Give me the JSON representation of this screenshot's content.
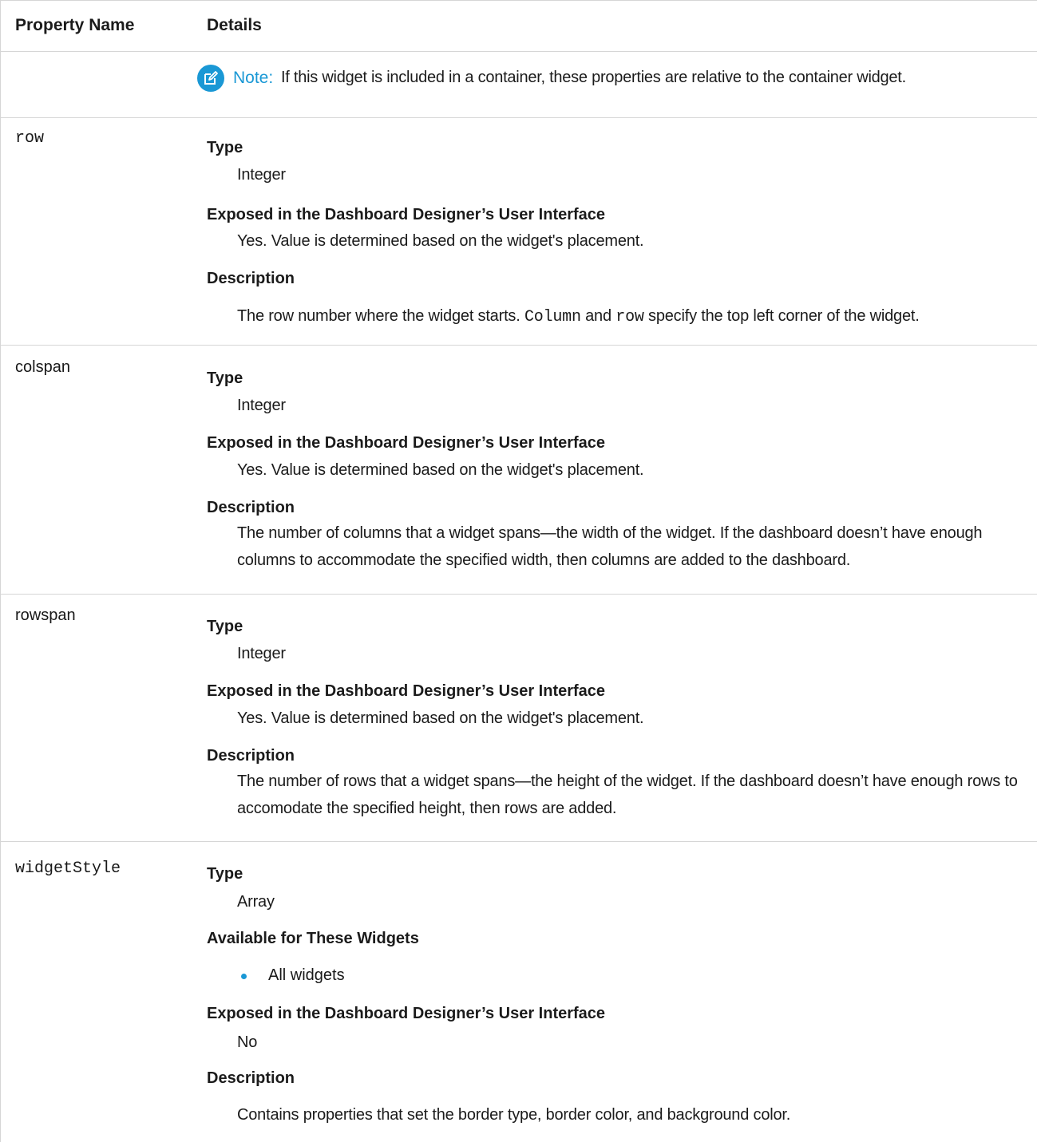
{
  "header": {
    "property_name": "Property Name",
    "details": "Details"
  },
  "note": {
    "label": "Note:",
    "text": "If this widget is included in a container, these properties are relative to the container widget."
  },
  "rows": {
    "row": {
      "name": "row",
      "type_label": "Type",
      "type_value": "Integer",
      "exposed_label": "Exposed in the Dashboard Designer’s User Interface",
      "exposed_value": "Yes. Value is determined based on the widget's placement.",
      "description_label": "Description",
      "description_part1": "The row number where the widget starts.",
      "description_code1": "Column",
      "description_part2": "and",
      "description_code2": "row",
      "description_part3": "specify the top left corner of the widget."
    },
    "colspan": {
      "name": "colspan",
      "type_label": "Type",
      "type_value": "Integer",
      "exposed_label": "Exposed in the Dashboard Designer’s User Interface",
      "exposed_value": "Yes. Value is determined based on the widget's placement.",
      "description_label": "Description",
      "description": "The number of columns that a widget spans—the width of the widget. If the dashboard doesn’t have enough columns to accommodate the specified width, then columns are added to the dashboard."
    },
    "rowspan": {
      "name": "rowspan",
      "type_label": "Type",
      "type_value": "Integer",
      "exposed_label": "Exposed in the Dashboard Designer’s User Interface",
      "exposed_value": "Yes. Value is determined based on the widget's placement.",
      "description_label": "Description",
      "description": "The number of rows that a widget spans—the height of the widget. If the dashboard doesn’t have enough rows to accomodate the specified height, then rows are added."
    },
    "widgetStyle": {
      "name": "widgetStyle",
      "type_label": "Type",
      "type_value": "Array",
      "available_label": "Available for These Widgets",
      "available_items": [
        "All widgets"
      ],
      "exposed_label": "Exposed in the Dashboard Designer’s User Interface",
      "exposed_value": "No",
      "description_label": "Description",
      "description": "Contains properties that set the border type, border color, and background color."
    }
  },
  "colors": {
    "accent": "#1a98d5",
    "text": "#1b1b1b",
    "rule": "#d6d6d6"
  }
}
